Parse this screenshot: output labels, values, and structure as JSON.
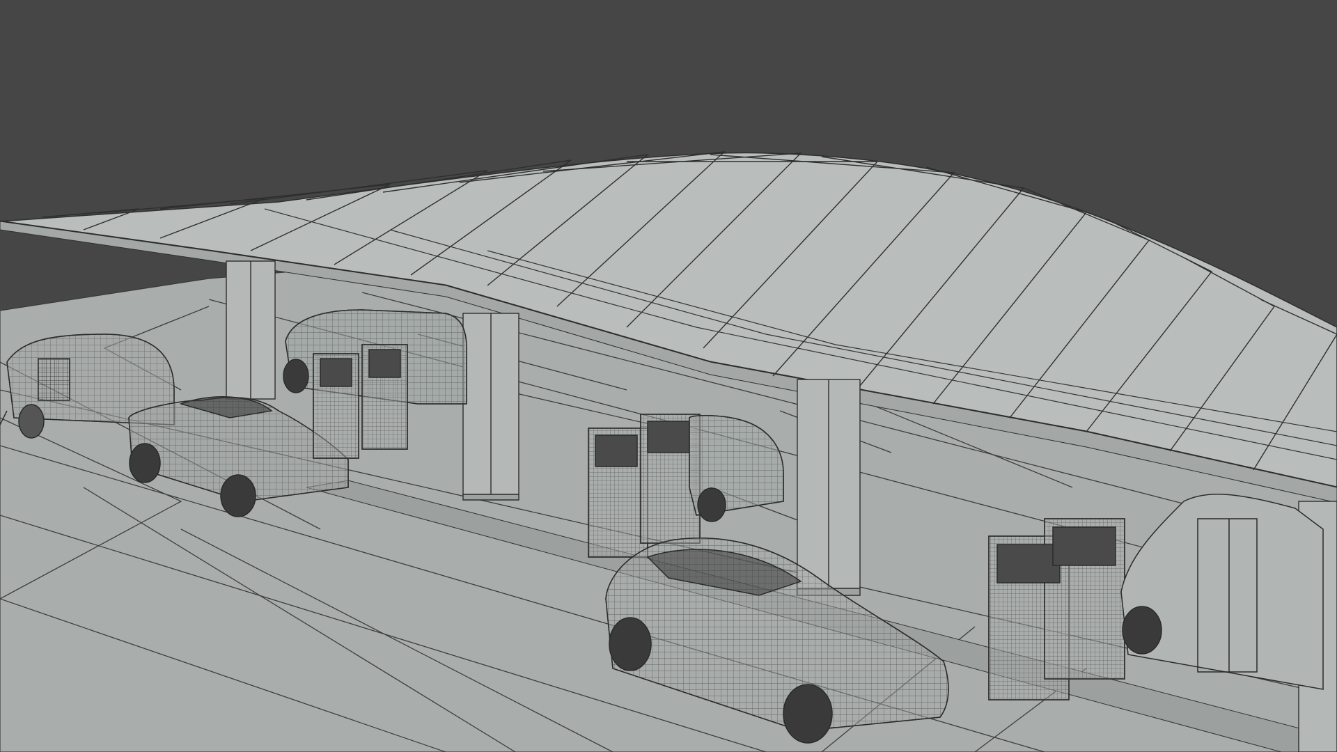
{
  "viewport": {
    "background": "#464646",
    "ground_fill": "#a9aeac",
    "canopy_fill": "#b9bdbc",
    "canopy_underside": "#a3a8a6",
    "column_fill": "#b4b8b6",
    "wire_color": "#2e2e2e",
    "mesh_line": "#3a3a3a"
  },
  "scene": {
    "objects": [
      {
        "name": "teardrop-trailer",
        "kind": "trailer"
      },
      {
        "name": "sedan-left",
        "kind": "car"
      },
      {
        "name": "van-back",
        "kind": "van"
      },
      {
        "name": "charger-pair-1",
        "kind": "charger"
      },
      {
        "name": "charger-pair-2",
        "kind": "charger"
      },
      {
        "name": "microcar",
        "kind": "car"
      },
      {
        "name": "crossover-front",
        "kind": "car"
      },
      {
        "name": "charger-pair-3",
        "kind": "charger"
      },
      {
        "name": "delivery-van-right",
        "kind": "van"
      }
    ]
  }
}
